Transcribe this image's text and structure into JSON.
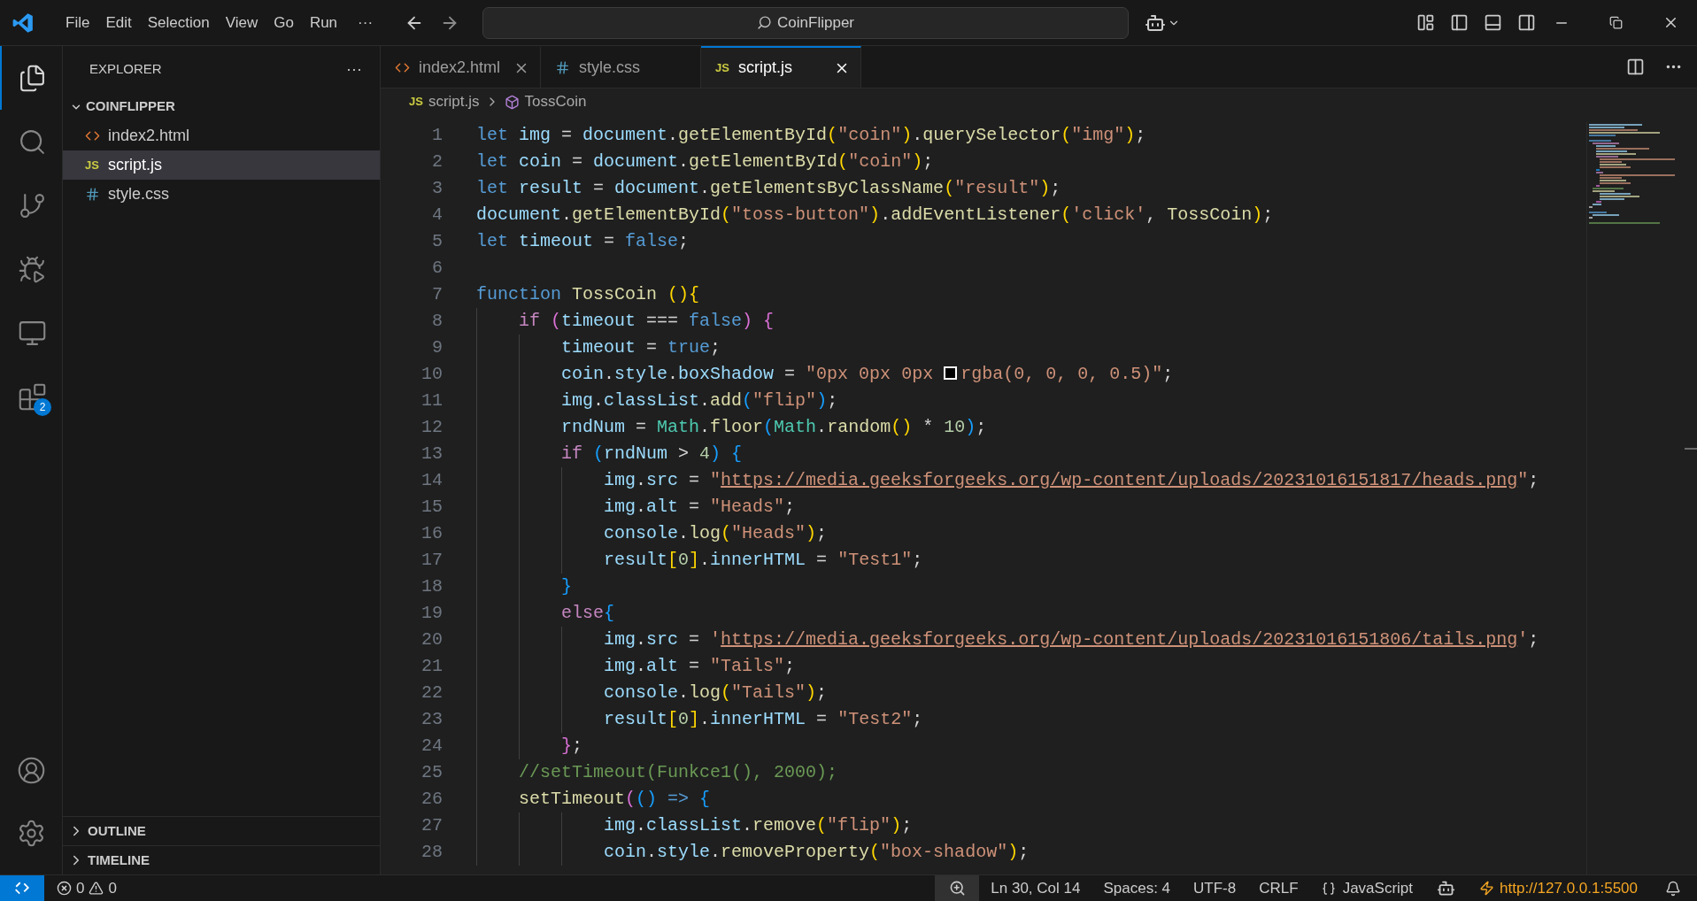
{
  "title_bar": {
    "menu": [
      "File",
      "Edit",
      "Selection",
      "View",
      "Go",
      "Run"
    ],
    "overflow": "···",
    "search": {
      "value": "CoinFlipper"
    }
  },
  "activity_bar": {
    "items": [
      {
        "kind": "explorer",
        "selected": true
      },
      {
        "kind": "search",
        "selected": false
      },
      {
        "kind": "source-control",
        "selected": false
      },
      {
        "kind": "run-debug",
        "selected": false
      },
      {
        "kind": "remote",
        "selected": false
      },
      {
        "kind": "extensions",
        "selected": false,
        "badge": "2"
      }
    ]
  },
  "sidebar": {
    "title": "EXPLORER",
    "more": "···",
    "folder": {
      "name": "COINFLIPPER",
      "expanded": true,
      "children": [
        {
          "name": "index2.html",
          "kind": "html",
          "selected": false
        },
        {
          "name": "script.js",
          "kind": "js",
          "icon_text": "JS",
          "selected": true
        },
        {
          "name": "style.css",
          "kind": "css",
          "selected": false
        }
      ]
    },
    "sections": [
      {
        "name": "OUTLINE",
        "expanded": false
      },
      {
        "name": "TIMELINE",
        "expanded": false
      }
    ]
  },
  "tabs": [
    {
      "label": "index2.html",
      "kind": "html",
      "selected": false,
      "closable": true
    },
    {
      "label": "style.css",
      "kind": "css",
      "selected": false,
      "closable": false
    },
    {
      "label": "script.js",
      "kind": "js",
      "icon_text": "JS",
      "selected": true,
      "closable": true
    }
  ],
  "breadcrumb": {
    "file": {
      "label": "script.js",
      "icon_text": "JS"
    },
    "symbol": "TossCoin"
  },
  "code": [
    {
      "number": "1",
      "tokens": [
        {
          "text": "let ",
          "kind": "kw"
        },
        {
          "text": "img",
          "kind": "var"
        },
        {
          "text": " = ",
          "kind": "pun"
        },
        {
          "text": "document",
          "kind": "var"
        },
        {
          "text": ".",
          "kind": "pun"
        },
        {
          "text": "getElementById",
          "kind": "fn"
        },
        {
          "text": "(",
          "kind": "b1"
        },
        {
          "text": "\"coin\"",
          "kind": "str"
        },
        {
          "text": ")",
          "kind": "b1"
        },
        {
          "text": ".",
          "kind": "pun"
        },
        {
          "text": "querySelector",
          "kind": "fn"
        },
        {
          "text": "(",
          "kind": "b1"
        },
        {
          "text": "\"img\"",
          "kind": "str"
        },
        {
          "text": ")",
          "kind": "b1"
        },
        {
          "text": ";",
          "kind": "pun"
        }
      ]
    },
    {
      "number": "2",
      "tokens": [
        {
          "text": "let ",
          "kind": "kw"
        },
        {
          "text": "coin",
          "kind": "var"
        },
        {
          "text": " = ",
          "kind": "pun"
        },
        {
          "text": "document",
          "kind": "var"
        },
        {
          "text": ".",
          "kind": "pun"
        },
        {
          "text": "getElementById",
          "kind": "fn"
        },
        {
          "text": "(",
          "kind": "b1"
        },
        {
          "text": "\"coin\"",
          "kind": "str"
        },
        {
          "text": ")",
          "kind": "b1"
        },
        {
          "text": ";",
          "kind": "pun"
        }
      ]
    },
    {
      "number": "3",
      "tokens": [
        {
          "text": "let ",
          "kind": "kw"
        },
        {
          "text": "result",
          "kind": "var"
        },
        {
          "text": " = ",
          "kind": "pun"
        },
        {
          "text": "document",
          "kind": "var"
        },
        {
          "text": ".",
          "kind": "pun"
        },
        {
          "text": "getElementsByClassName",
          "kind": "fn"
        },
        {
          "text": "(",
          "kind": "b1"
        },
        {
          "text": "\"result\"",
          "kind": "str"
        },
        {
          "text": ")",
          "kind": "b1"
        },
        {
          "text": ";",
          "kind": "pun"
        }
      ]
    },
    {
      "number": "4",
      "tokens": [
        {
          "text": "document",
          "kind": "var"
        },
        {
          "text": ".",
          "kind": "pun"
        },
        {
          "text": "getElementById",
          "kind": "fn"
        },
        {
          "text": "(",
          "kind": "b1"
        },
        {
          "text": "\"toss-button\"",
          "kind": "str"
        },
        {
          "text": ")",
          "kind": "b1"
        },
        {
          "text": ".",
          "kind": "pun"
        },
        {
          "text": "addEventListener",
          "kind": "fn"
        },
        {
          "text": "(",
          "kind": "b1"
        },
        {
          "text": "'click'",
          "kind": "str"
        },
        {
          "text": ", ",
          "kind": "pun"
        },
        {
          "text": "TossCoin",
          "kind": "fn"
        },
        {
          "text": ")",
          "kind": "b1"
        },
        {
          "text": ";",
          "kind": "pun"
        }
      ]
    },
    {
      "number": "5",
      "tokens": [
        {
          "text": "let ",
          "kind": "kw"
        },
        {
          "text": "timeout",
          "kind": "var"
        },
        {
          "text": " = ",
          "kind": "pun"
        },
        {
          "text": "false",
          "kind": "kw"
        },
        {
          "text": ";",
          "kind": "pun"
        }
      ]
    },
    {
      "number": "6"
    },
    {
      "number": "7",
      "tokens": [
        {
          "text": "function ",
          "kind": "kw"
        },
        {
          "text": "TossCoin ",
          "kind": "fn"
        },
        {
          "text": "(){",
          "kind": "b1"
        }
      ]
    },
    {
      "number": "8",
      "tokens": [
        {
          "text": "    if ",
          "kind": "ctl"
        },
        {
          "text": "(",
          "kind": "b2"
        },
        {
          "text": "timeout",
          "kind": "var"
        },
        {
          "text": " === ",
          "kind": "pun"
        },
        {
          "text": "false",
          "kind": "kw"
        },
        {
          "text": ")",
          "kind": "b2"
        },
        {
          "text": " {",
          "kind": "b2"
        }
      ]
    },
    {
      "number": "9",
      "tokens": [
        {
          "text": "        timeout",
          "kind": "var"
        },
        {
          "text": " = ",
          "kind": "pun"
        },
        {
          "text": "true",
          "kind": "kw"
        },
        {
          "text": ";",
          "kind": "pun"
        }
      ]
    },
    {
      "number": "10",
      "tokens": [
        {
          "text": "        coin",
          "kind": "var"
        },
        {
          "text": ".",
          "kind": "pun"
        },
        {
          "text": "style",
          "kind": "var"
        },
        {
          "text": ".",
          "kind": "pun"
        },
        {
          "text": "boxShadow",
          "kind": "var"
        },
        {
          "text": " = ",
          "kind": "pun"
        },
        {
          "text": "\"0px 0px 0px ",
          "kind": "str"
        },
        {
          "kind": "swatch"
        },
        {
          "text": "rgba(0, 0, 0, 0.5)\"",
          "kind": "str"
        },
        {
          "text": ";",
          "kind": "pun"
        }
      ]
    },
    {
      "number": "11",
      "tokens": [
        {
          "text": "        img",
          "kind": "var"
        },
        {
          "text": ".",
          "kind": "pun"
        },
        {
          "text": "classList",
          "kind": "var"
        },
        {
          "text": ".",
          "kind": "pun"
        },
        {
          "text": "add",
          "kind": "fn"
        },
        {
          "text": "(",
          "kind": "b3"
        },
        {
          "text": "\"flip\"",
          "kind": "str"
        },
        {
          "text": ")",
          "kind": "b3"
        },
        {
          "text": ";",
          "kind": "pun"
        }
      ]
    },
    {
      "number": "12",
      "tokens": [
        {
          "text": "        rndNum",
          "kind": "var"
        },
        {
          "text": " = ",
          "kind": "pun"
        },
        {
          "text": "Math",
          "kind": "cls"
        },
        {
          "text": ".",
          "kind": "pun"
        },
        {
          "text": "floor",
          "kind": "fn"
        },
        {
          "text": "(",
          "kind": "b3"
        },
        {
          "text": "Math",
          "kind": "cls"
        },
        {
          "text": ".",
          "kind": "pun"
        },
        {
          "text": "random",
          "kind": "fn"
        },
        {
          "text": "()",
          "kind": "b1"
        },
        {
          "text": " * ",
          "kind": "pun"
        },
        {
          "text": "10",
          "kind": "num"
        },
        {
          "text": ")",
          "kind": "b3"
        },
        {
          "text": ";",
          "kind": "pun"
        }
      ]
    },
    {
      "number": "13",
      "tokens": [
        {
          "text": "        if ",
          "kind": "ctl"
        },
        {
          "text": "(",
          "kind": "b3"
        },
        {
          "text": "rndNum",
          "kind": "var"
        },
        {
          "text": " > ",
          "kind": "pun"
        },
        {
          "text": "4",
          "kind": "num"
        },
        {
          "text": ")",
          "kind": "b3"
        },
        {
          "text": " {",
          "kind": "b3"
        }
      ]
    },
    {
      "number": "14",
      "tokens": [
        {
          "text": "            img",
          "kind": "var"
        },
        {
          "text": ".",
          "kind": "pun"
        },
        {
          "text": "src",
          "kind": "var"
        },
        {
          "text": " = ",
          "kind": "pun"
        },
        {
          "text": "\"",
          "kind": "str"
        },
        {
          "text": "https://media.geeksforgeeks.org/wp-content/uploads/20231016151817/heads.png",
          "kind": "url"
        },
        {
          "text": "\"",
          "kind": "str"
        },
        {
          "text": ";",
          "kind": "pun"
        }
      ]
    },
    {
      "number": "15",
      "tokens": [
        {
          "text": "            img",
          "kind": "var"
        },
        {
          "text": ".",
          "kind": "pun"
        },
        {
          "text": "alt",
          "kind": "var"
        },
        {
          "text": " = ",
          "kind": "pun"
        },
        {
          "text": "\"Heads\"",
          "kind": "str"
        },
        {
          "text": ";",
          "kind": "pun"
        }
      ]
    },
    {
      "number": "16",
      "tokens": [
        {
          "text": "            console",
          "kind": "var"
        },
        {
          "text": ".",
          "kind": "pun"
        },
        {
          "text": "log",
          "kind": "fn"
        },
        {
          "text": "(",
          "kind": "b1"
        },
        {
          "text": "\"Heads\"",
          "kind": "str"
        },
        {
          "text": ")",
          "kind": "b1"
        },
        {
          "text": ";",
          "kind": "pun"
        }
      ]
    },
    {
      "number": "17",
      "tokens": [
        {
          "text": "            result",
          "kind": "var"
        },
        {
          "text": "[",
          "kind": "b1"
        },
        {
          "text": "0",
          "kind": "num"
        },
        {
          "text": "]",
          "kind": "b1"
        },
        {
          "text": ".",
          "kind": "pun"
        },
        {
          "text": "innerHTML",
          "kind": "var"
        },
        {
          "text": " = ",
          "kind": "pun"
        },
        {
          "text": "\"Test1\"",
          "kind": "str"
        },
        {
          "text": ";",
          "kind": "pun"
        }
      ]
    },
    {
      "number": "18",
      "tokens": [
        {
          "text": "        }",
          "kind": "b3"
        }
      ]
    },
    {
      "number": "19",
      "tokens": [
        {
          "text": "        else",
          "kind": "ctl"
        },
        {
          "text": "{",
          "kind": "b3"
        }
      ]
    },
    {
      "number": "20",
      "tokens": [
        {
          "text": "            img",
          "kind": "var"
        },
        {
          "text": ".",
          "kind": "pun"
        },
        {
          "text": "src",
          "kind": "var"
        },
        {
          "text": " = ",
          "kind": "pun"
        },
        {
          "text": "'",
          "kind": "str"
        },
        {
          "text": "https://media.geeksforgeeks.org/wp-content/uploads/20231016151806/tails.png",
          "kind": "url"
        },
        {
          "text": "'",
          "kind": "str"
        },
        {
          "text": ";",
          "kind": "pun"
        }
      ]
    },
    {
      "number": "21",
      "tokens": [
        {
          "text": "            img",
          "kind": "var"
        },
        {
          "text": ".",
          "kind": "pun"
        },
        {
          "text": "alt",
          "kind": "var"
        },
        {
          "text": " = ",
          "kind": "pun"
        },
        {
          "text": "\"Tails\"",
          "kind": "str"
        },
        {
          "text": ";",
          "kind": "pun"
        }
      ]
    },
    {
      "number": "22",
      "tokens": [
        {
          "text": "            console",
          "kind": "var"
        },
        {
          "text": ".",
          "kind": "pun"
        },
        {
          "text": "log",
          "kind": "fn"
        },
        {
          "text": "(",
          "kind": "b1"
        },
        {
          "text": "\"Tails\"",
          "kind": "str"
        },
        {
          "text": ")",
          "kind": "b1"
        },
        {
          "text": ";",
          "kind": "pun"
        }
      ]
    },
    {
      "number": "23",
      "tokens": [
        {
          "text": "            result",
          "kind": "var"
        },
        {
          "text": "[",
          "kind": "b1"
        },
        {
          "text": "0",
          "kind": "num"
        },
        {
          "text": "]",
          "kind": "b1"
        },
        {
          "text": ".",
          "kind": "pun"
        },
        {
          "text": "innerHTML",
          "kind": "var"
        },
        {
          "text": " = ",
          "kind": "pun"
        },
        {
          "text": "\"Test2\"",
          "kind": "str"
        },
        {
          "text": ";",
          "kind": "pun"
        }
      ]
    },
    {
      "number": "24",
      "tokens": [
        {
          "text": "        }",
          "kind": "b2"
        },
        {
          "text": ";",
          "kind": "pun"
        }
      ]
    },
    {
      "number": "25",
      "tokens": [
        {
          "text": "    //setTimeout(Funkce1(), 2000);",
          "kind": "com"
        }
      ]
    },
    {
      "number": "26",
      "tokens": [
        {
          "text": "    setTimeout",
          "kind": "fn"
        },
        {
          "text": "(",
          "kind": "b2"
        },
        {
          "text": "()",
          "kind": "b3"
        },
        {
          "text": " =>",
          "kind": "kw"
        },
        {
          "text": " {",
          "kind": "b3"
        }
      ]
    },
    {
      "number": "27",
      "tokens": [
        {
          "text": "            img",
          "kind": "var"
        },
        {
          "text": ".",
          "kind": "pun"
        },
        {
          "text": "classList",
          "kind": "var"
        },
        {
          "text": ".",
          "kind": "pun"
        },
        {
          "text": "remove",
          "kind": "fn"
        },
        {
          "text": "(",
          "kind": "b1"
        },
        {
          "text": "\"flip\"",
          "kind": "str"
        },
        {
          "text": ")",
          "kind": "b1"
        },
        {
          "text": ";",
          "kind": "pun"
        }
      ]
    },
    {
      "number": "28",
      "tokens": [
        {
          "text": "            coin",
          "kind": "var"
        },
        {
          "text": ".",
          "kind": "pun"
        },
        {
          "text": "style",
          "kind": "var"
        },
        {
          "text": ".",
          "kind": "pun"
        },
        {
          "text": "removeProperty",
          "kind": "fn"
        },
        {
          "text": "(",
          "kind": "b1"
        },
        {
          "text": "\"box-shadow\"",
          "kind": "str"
        },
        {
          "text": ")",
          "kind": "b1"
        },
        {
          "text": ";",
          "kind": "pun"
        }
      ]
    }
  ],
  "status_bar": {
    "errors": "0",
    "warnings": "0",
    "position": "Ln 30, Col 14",
    "indentation": "Spaces: 4",
    "encoding": "UTF-8",
    "line_ending": "CRLF",
    "language": "JavaScript",
    "live_server": "http://127.0.0.1:5500"
  }
}
